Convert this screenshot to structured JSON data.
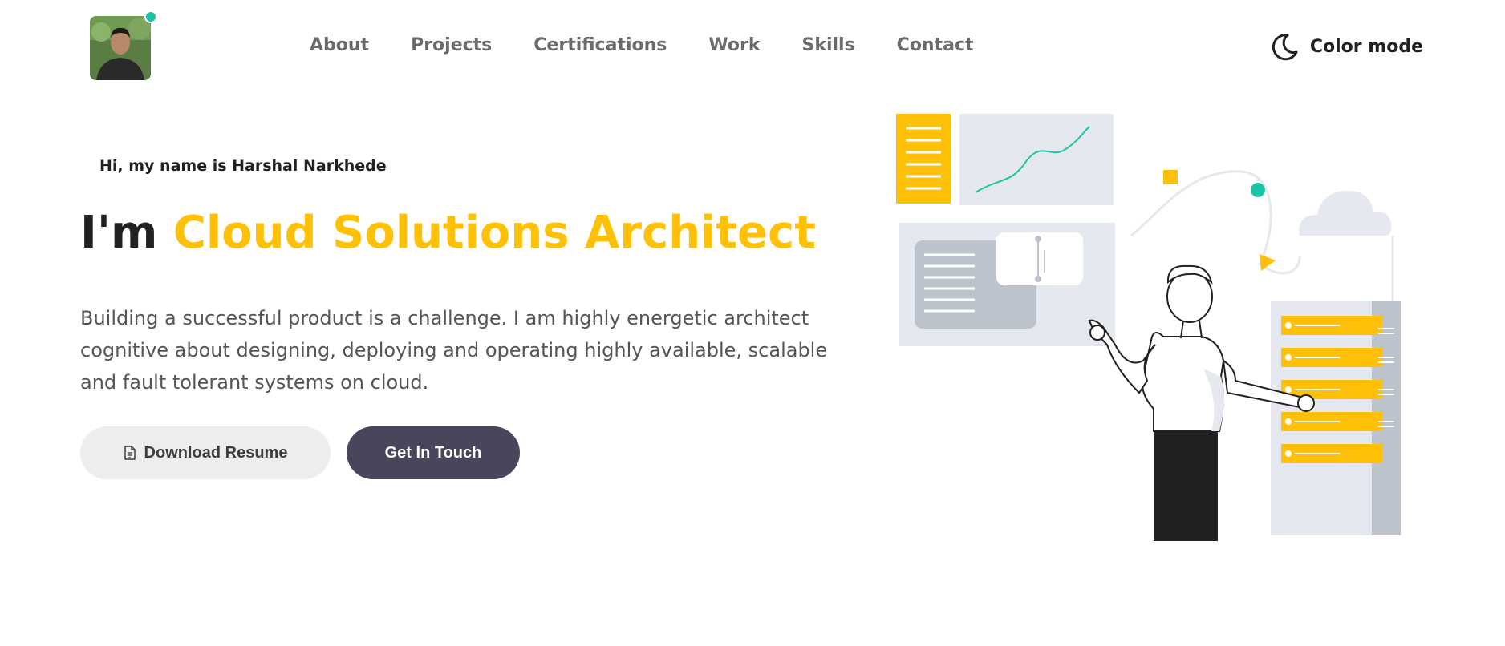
{
  "header": {
    "avatar_alt": "profile photo",
    "nav": [
      {
        "label": "About"
      },
      {
        "label": "Projects"
      },
      {
        "label": "Certifications"
      },
      {
        "label": "Work"
      },
      {
        "label": "Skills"
      },
      {
        "label": "Contact"
      }
    ],
    "color_mode": {
      "label": "Color mode",
      "icon": "moon-icon"
    }
  },
  "hero": {
    "greeting": "Hi, my name is Harshal Narkhede",
    "headline_prefix": "I'm",
    "headline_role": "Cloud Solutions Architect",
    "description": "Building a successful product is a challenge. I am highly energetic architect cognitive about designing, deploying and operating highly available, scalable and fault tolerant systems on cloud.",
    "buttons": {
      "resume": {
        "label": "Download Resume",
        "icon": "document-icon"
      },
      "contact": {
        "label": "Get In Touch"
      }
    }
  },
  "colors": {
    "accent": "#ffc107",
    "teal": "#19c5a4",
    "dark_button": "#48465a",
    "light_button": "#ededed",
    "panel": "#e6e8f0",
    "panel_dark": "#bcc3cd"
  }
}
